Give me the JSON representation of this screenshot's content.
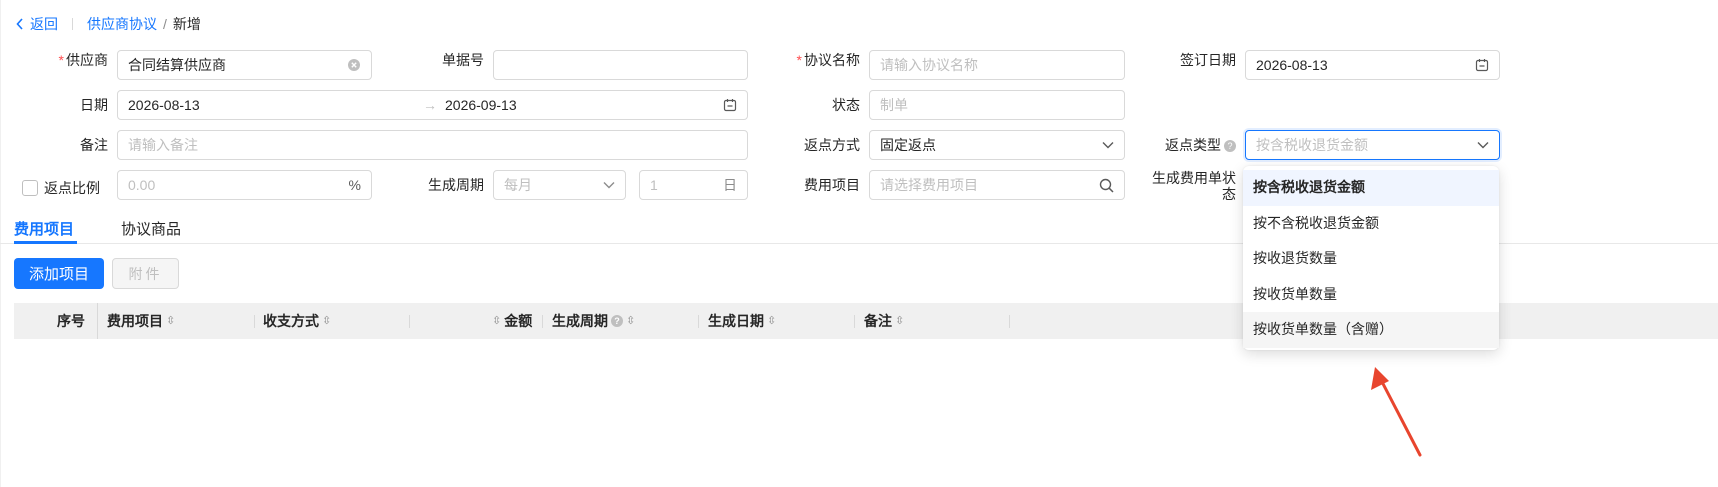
{
  "breadcrumb": {
    "back": "返回",
    "parent": "供应商协议",
    "separator": "/",
    "current": "新增"
  },
  "form": {
    "supplier": {
      "label": "供应商",
      "value": "合同结算供应商"
    },
    "doc_no": {
      "label": "单据号",
      "value": ""
    },
    "agreement_name": {
      "label": "协议名称",
      "placeholder": "请输入协议名称"
    },
    "sign_date": {
      "label": "签订日期",
      "value": "2026-08-13"
    },
    "date": {
      "label": "日期",
      "start": "2026-08-13",
      "arrow": "→",
      "end": "2026-09-13"
    },
    "status": {
      "label": "状态",
      "value": "制单"
    },
    "remark": {
      "label": "备注",
      "placeholder": "请输入备注"
    },
    "rebate_method": {
      "label": "返点方式",
      "value": "固定返点"
    },
    "rebate_type": {
      "label": "返点类型",
      "placeholder": "按含税收退货金额"
    },
    "rebate_ratio": {
      "label": "返点比例",
      "placeholder": "0.00",
      "suffix": "%"
    },
    "cycle": {
      "label": "生成周期",
      "unit_value": "每月",
      "num_placeholder": "1",
      "num_suffix": "日"
    },
    "fee_item": {
      "label": "费用项目",
      "placeholder": "请选择费用项目"
    },
    "fee_status": {
      "label_line1": "生成费用单状",
      "label_line2": "态"
    }
  },
  "tabs": [
    {
      "label": "费用项目"
    },
    {
      "label": "协议商品"
    }
  ],
  "buttons": {
    "add_item": "添加项目",
    "attachment": "附件"
  },
  "table": {
    "columns": [
      "序号",
      "费用项目",
      "收支方式",
      "金额",
      "生成周期",
      "生成日期",
      "备注"
    ]
  },
  "dropdown": {
    "options": [
      "按含税收退货金额",
      "按不含税收退货金额",
      "按收退货数量",
      "按收货单数量",
      "按收货单数量（含赠）"
    ]
  },
  "colors": {
    "primary": "#1677ff",
    "required": "#ff4d4f",
    "annotation_arrow": "#e8452e"
  }
}
